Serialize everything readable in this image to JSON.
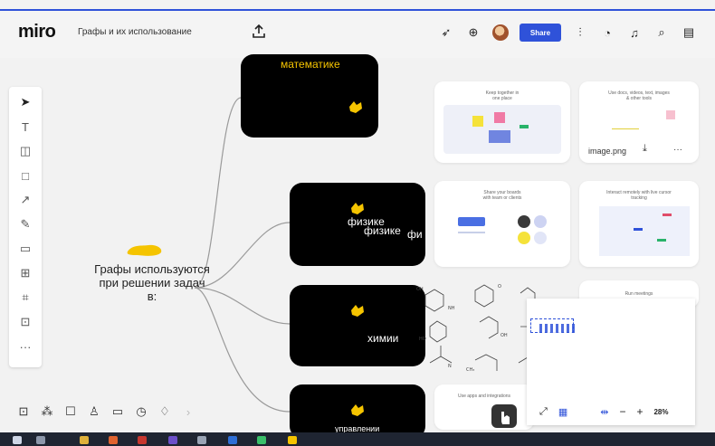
{
  "app": {
    "logo": "miro",
    "board_name": "Графы и их использование"
  },
  "topbar": {
    "share_label": "Share",
    "icons": [
      "cursor-icon",
      "reactions-icon",
      "avatar",
      "share-button",
      "apps-icon",
      "collaborate-icon",
      "bell-icon",
      "search-icon",
      "notes-icon"
    ]
  },
  "colors": {
    "accent": "#2f52d9",
    "node": "#000000",
    "sticker": "#f5c400",
    "topline": "#2f52d9"
  },
  "mindmap": {
    "center": "Графы используются при решении задач в:",
    "nodes": [
      {
        "label": "математике"
      },
      {
        "label": "физике",
        "overlap_labels": [
          "физике",
          "фи"
        ]
      },
      {
        "label": "химии"
      },
      {
        "label": "управлении"
      }
    ]
  },
  "left_tools": [
    "select-tool",
    "text-tool",
    "sticky-note-tool",
    "shape-tool",
    "pen-line-tool",
    "pencil-tool",
    "comment-tool",
    "frame-tool",
    "grid-tool",
    "upload-tool",
    "more-tool"
  ],
  "bottom_tools": [
    "present-icon",
    "grid-icon",
    "comment-icon",
    "like-icon",
    "video-icon",
    "timer-icon",
    "pin-icon"
  ],
  "cards": [
    {
      "title": "Keep together in one place"
    },
    {
      "title": "Use docs, videos, text, images & other tools"
    },
    {
      "title": "Share your boards with team or clients"
    },
    {
      "title": "Interact remotely with live cursor tracking"
    },
    {
      "title": "Run meetings"
    },
    {
      "title": "Use apps and integrations"
    }
  ],
  "file_card": {
    "filename": "image.png",
    "more": "···"
  },
  "zoom": {
    "level": "28%",
    "minus": "−",
    "plus": "+"
  }
}
